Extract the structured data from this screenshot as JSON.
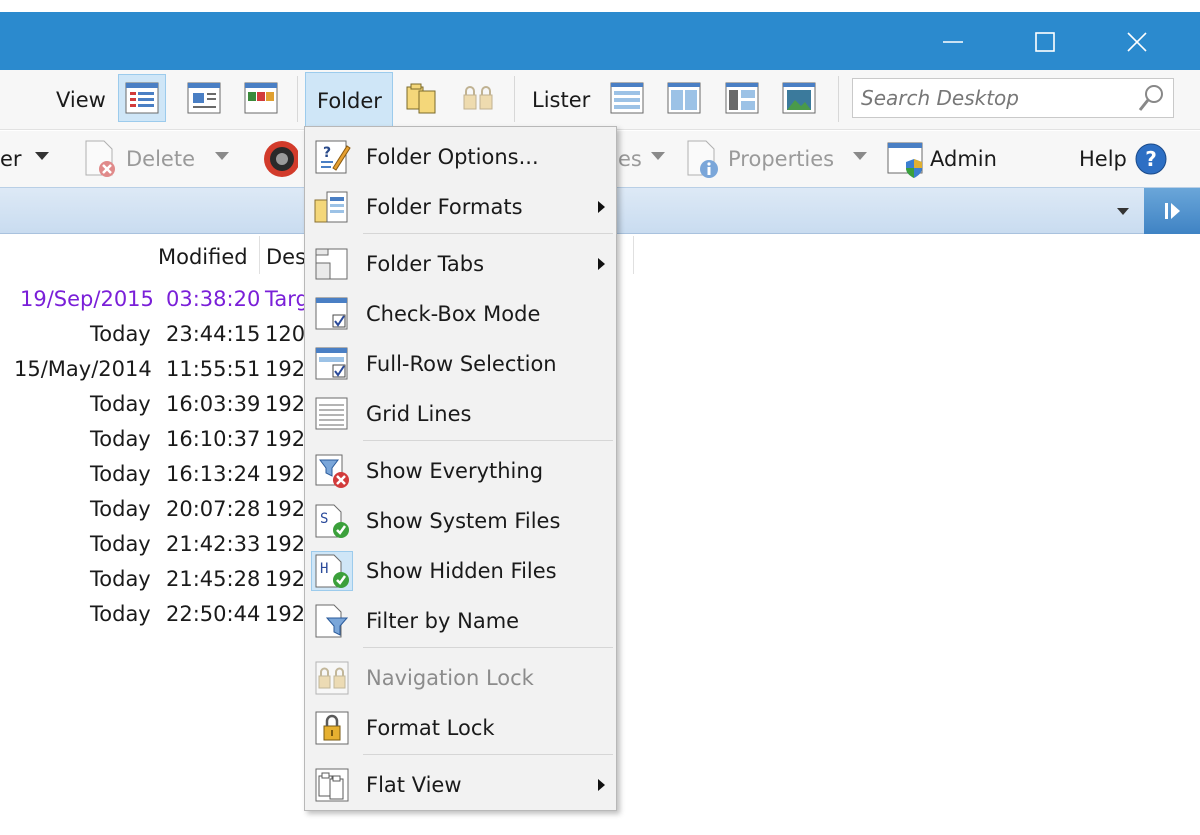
{
  "window": {
    "controls": {
      "minimize": "minimize-icon",
      "maximize": "maximize-icon",
      "close": "close-icon"
    }
  },
  "toolbar1": {
    "view_label": "View",
    "folder_label": "Folder",
    "lister_label": "Lister",
    "search_placeholder": "Search Desktop"
  },
  "toolbar2": {
    "partial_left": "er",
    "delete_label": "Delete",
    "partial_middle": "es",
    "properties_label": "Properties",
    "admin_label": "Admin",
    "help_label": "Help"
  },
  "list": {
    "columns": {
      "modified": "Modified",
      "description": "Des"
    },
    "rows": [
      {
        "date": "19/Sep/2015",
        "time": "03:38:20",
        "desc": "Targ",
        "purple": true
      },
      {
        "date": "Today",
        "time": "23:44:15",
        "desc": "120"
      },
      {
        "date": "15/May/2014",
        "time": "11:55:51",
        "desc": "192"
      },
      {
        "date": "Today",
        "time": "16:03:39",
        "desc": "192"
      },
      {
        "date": "Today",
        "time": "16:10:37",
        "desc": "192"
      },
      {
        "date": "Today",
        "time": "16:13:24",
        "desc": "192"
      },
      {
        "date": "Today",
        "time": "20:07:28",
        "desc": "192"
      },
      {
        "date": "Today",
        "time": "21:42:33",
        "desc": "192"
      },
      {
        "date": "Today",
        "time": "21:45:28",
        "desc": "192"
      },
      {
        "date": "Today",
        "time": "22:50:44",
        "desc": "192"
      }
    ]
  },
  "menu": {
    "items": [
      {
        "label": "Folder Options...",
        "icon": "folder-options-icon"
      },
      {
        "label": "Folder Formats",
        "icon": "folder-formats-icon",
        "submenu": true
      },
      {
        "label": "Folder Tabs",
        "icon": "folder-tabs-icon",
        "submenu": true
      },
      {
        "label": "Check-Box Mode",
        "icon": "check-box-mode-icon"
      },
      {
        "label": "Full-Row Selection",
        "icon": "full-row-selection-icon"
      },
      {
        "label": "Grid Lines",
        "icon": "grid-lines-icon"
      },
      {
        "label": "Show Everything",
        "icon": "show-everything-icon"
      },
      {
        "label": "Show System Files",
        "icon": "show-system-files-icon"
      },
      {
        "label": "Show Hidden Files",
        "icon": "show-hidden-files-icon",
        "selected": true
      },
      {
        "label": "Filter by Name",
        "icon": "filter-by-name-icon"
      },
      {
        "label": "Navigation Lock",
        "icon": "navigation-lock-icon",
        "disabled": true
      },
      {
        "label": "Format Lock",
        "icon": "format-lock-icon"
      },
      {
        "label": "Flat View",
        "icon": "flat-view-icon",
        "submenu": true
      }
    ]
  }
}
